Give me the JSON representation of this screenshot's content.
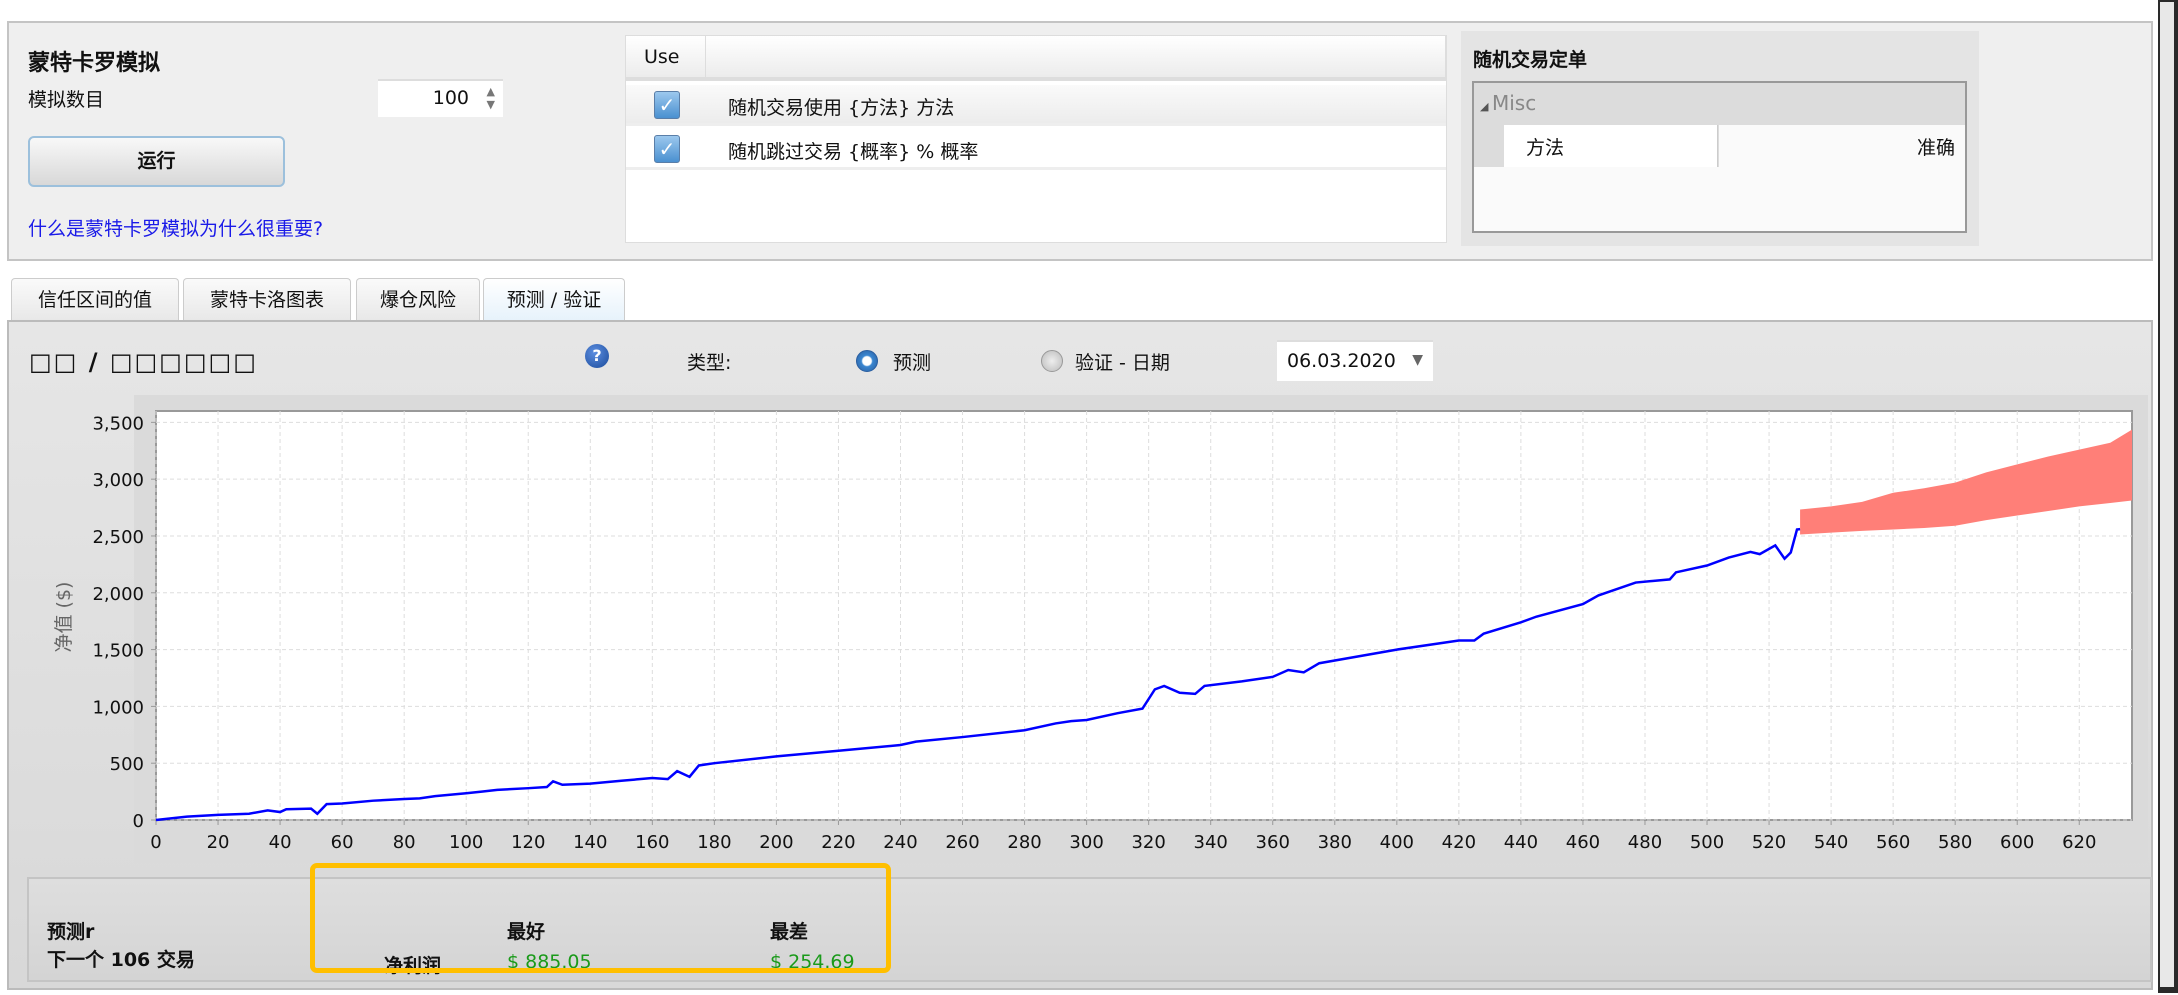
{
  "top": {
    "title": "蒙特卡罗模拟",
    "sim_count_label": "模拟数目",
    "sim_count_value": "100",
    "run_button": "运行",
    "help_link": "什么是蒙特卡罗模拟为什么很重要?",
    "use_table": {
      "header": "Use",
      "rows": [
        {
          "checked": true,
          "label": "随机交易使用 {方法} 方法"
        },
        {
          "checked": true,
          "label": "随机跳过交易 {概率} % 概率"
        }
      ]
    },
    "order_group": {
      "title": "随机交易定单",
      "category": "Misc",
      "property_name": "方法",
      "property_value": "准确"
    }
  },
  "tabs": [
    {
      "label": "信任区间的值",
      "active": false
    },
    {
      "label": "蒙特卡洛图表",
      "active": false
    },
    {
      "label": "爆仓风险",
      "active": false
    },
    {
      "label": "预测 / 验证",
      "active": true
    }
  ],
  "panel": {
    "title": "□□ / □□□□□□",
    "help_icon": "?",
    "type_label": "类型:",
    "radio_forecast": "预测",
    "radio_verify": "验证 - 日期",
    "selected": "forecast",
    "date_value": "06.03.2020"
  },
  "summary": {
    "line1": "预测r",
    "line2": "下一个 106 交易",
    "best_header": "最好",
    "worst_header": "最差",
    "row_label": "净利润",
    "best_value": "$ 885.05",
    "worst_value": "$ 254.69"
  },
  "colors": {
    "line": "#0000ff",
    "band": "#ff7f78",
    "highlight": "#ffbf00",
    "value": "#1a9a1a"
  },
  "chart_data": {
    "type": "line",
    "title": "",
    "xlabel": "",
    "ylabel": "净值 ($)",
    "xlim": [
      0,
      637
    ],
    "ylim": [
      0,
      3600
    ],
    "grid": true,
    "x_ticks": [
      0,
      20,
      40,
      60,
      80,
      100,
      120,
      140,
      160,
      180,
      200,
      220,
      240,
      260,
      280,
      300,
      320,
      340,
      360,
      380,
      400,
      420,
      440,
      460,
      480,
      500,
      520,
      540,
      560,
      580,
      600,
      620
    ],
    "y_ticks": [
      0,
      500,
      1000,
      1500,
      2000,
      2500,
      3000,
      3500
    ],
    "y_tick_labels": [
      "0",
      "500",
      "1,000",
      "1,500",
      "2,000",
      "2,500",
      "3,000",
      "3,500"
    ],
    "series": [
      {
        "name": "equity",
        "x": [
          0,
          10,
          20,
          30,
          36,
          40,
          42,
          50,
          52,
          55,
          60,
          70,
          80,
          85,
          90,
          100,
          105,
          110,
          120,
          126,
          128,
          131,
          140,
          150,
          160,
          165,
          168,
          172,
          175,
          180,
          200,
          220,
          240,
          245,
          260,
          280,
          290,
          295,
          300,
          310,
          318,
          322,
          325,
          330,
          335,
          338,
          350,
          360,
          365,
          370,
          375,
          400,
          420,
          425,
          428,
          440,
          445,
          460,
          465,
          477,
          488,
          490,
          500,
          507,
          514,
          517,
          522,
          525,
          527,
          529,
          530
        ],
        "y": [
          0,
          30,
          45,
          55,
          85,
          70,
          95,
          100,
          55,
          140,
          145,
          170,
          185,
          190,
          210,
          235,
          250,
          265,
          280,
          290,
          340,
          310,
          320,
          345,
          370,
          360,
          430,
          380,
          480,
          500,
          560,
          610,
          660,
          690,
          730,
          790,
          850,
          870,
          880,
          940,
          980,
          1150,
          1180,
          1120,
          1110,
          1180,
          1220,
          1260,
          1320,
          1300,
          1380,
          1500,
          1580,
          1580,
          1640,
          1740,
          1790,
          1900,
          1977,
          2090,
          2118,
          2180,
          2240,
          2310,
          2360,
          2340,
          2417,
          2300,
          2355,
          2557,
          2560
        ]
      },
      {
        "name": "forecast-band",
        "x": [
          530,
          540,
          550,
          560,
          570,
          580,
          590,
          600,
          610,
          620,
          630,
          637
        ],
        "upper": [
          2733,
          2760,
          2800,
          2880,
          2920,
          2970,
          3060,
          3130,
          3200,
          3260,
          3320,
          3436
        ],
        "lower": [
          2513,
          2530,
          2545,
          2557,
          2570,
          2590,
          2640,
          2680,
          2720,
          2760,
          2790,
          2812
        ]
      }
    ]
  }
}
